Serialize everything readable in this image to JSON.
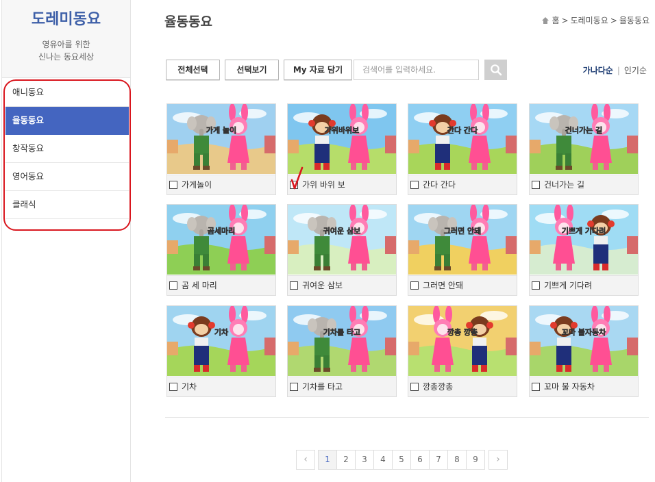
{
  "sidebar": {
    "title": "도레미동요",
    "subtitle_line1": "영유아를 위한",
    "subtitle_line2": "신나는 동요세상",
    "items": [
      {
        "label": "애니동요",
        "active": false
      },
      {
        "label": "율동동요",
        "active": true
      },
      {
        "label": "창작동요",
        "active": false
      },
      {
        "label": "영어동요",
        "active": false
      },
      {
        "label": "클래식",
        "active": false
      }
    ]
  },
  "header": {
    "title": "율동동요",
    "breadcrumb": {
      "home": "홈",
      "sep": ">",
      "level1": "도레미동요",
      "level2": "율동동요"
    }
  },
  "toolbar": {
    "select_all": "전체선택",
    "view_selected": "선택보기",
    "my_data": "My 자료 담기",
    "search_placeholder": "검색어를 입력하세요.",
    "sort_alpha": "가나다순",
    "sort_sep": "|",
    "sort_popular": "인기순"
  },
  "videos": [
    {
      "title": "가게놀이",
      "overlay": "가게 놀이",
      "sky": "#9fd0f0",
      "ground": "#e8c98a",
      "left": "elephant",
      "right": "rabbit"
    },
    {
      "title": "가위 바위 보",
      "overlay": "가위바위보",
      "sky": "#7fc6ef",
      "ground": "#b6dd6a",
      "left": "monkey",
      "right": "rabbit"
    },
    {
      "title": "간다 간다",
      "overlay": "간다 간다",
      "sky": "#8fcff2",
      "ground": "#a8d65a",
      "left": "monkey",
      "right": "rabbit"
    },
    {
      "title": "건너가는 길",
      "overlay": "건너가는 길",
      "sky": "#a6d8f4",
      "ground": "#9fd05a",
      "left": "elephant",
      "right": "rabbit"
    },
    {
      "title": "곰 세 마리",
      "overlay": "곰세마리",
      "sky": "#8fd0ef",
      "ground": "#8ecf55",
      "left": "elephant",
      "right": "rabbit"
    },
    {
      "title": "귀여운 삼보",
      "overlay": "귀여운 삼보",
      "sky": "#bfe7f7",
      "ground": "#d8efc0",
      "left": "elephant",
      "right": "rabbit"
    },
    {
      "title": "그러면 안돼",
      "overlay": "그러면 안돼",
      "sky": "#9fd6f2",
      "ground": "#f0d060",
      "left": "elephant",
      "right": "rabbit"
    },
    {
      "title": "기쁘게 기다려",
      "overlay": "기쁘게 기다려",
      "sky": "#9fdcf4",
      "ground": "#d6ecd0",
      "left": "rabbit",
      "right": "monkey"
    },
    {
      "title": "기차",
      "overlay": "기차",
      "sky": "#9fd4f0",
      "ground": "#a5d65a",
      "left": "monkey",
      "right": "rabbit"
    },
    {
      "title": "기차를 타고",
      "overlay": "기차를 타고",
      "sky": "#8fcaf0",
      "ground": "#b0d870",
      "left": "elephant",
      "right": "rabbit"
    },
    {
      "title": "깡총깡총",
      "overlay": "깡총 깡총",
      "sky": "#f2d070",
      "ground": "#b8e070",
      "left": "rabbit",
      "right": "monkey"
    },
    {
      "title": "꼬마 불 자동차",
      "overlay": "꼬마 불자동차",
      "sky": "#a9d8f2",
      "ground": "#a8d66a",
      "left": "monkey",
      "right": "rabbit"
    }
  ],
  "pagination": {
    "prev": "‹",
    "next": "›",
    "pages": [
      "1",
      "2",
      "3",
      "4",
      "5",
      "6",
      "7",
      "8",
      "9"
    ],
    "current": "1"
  }
}
